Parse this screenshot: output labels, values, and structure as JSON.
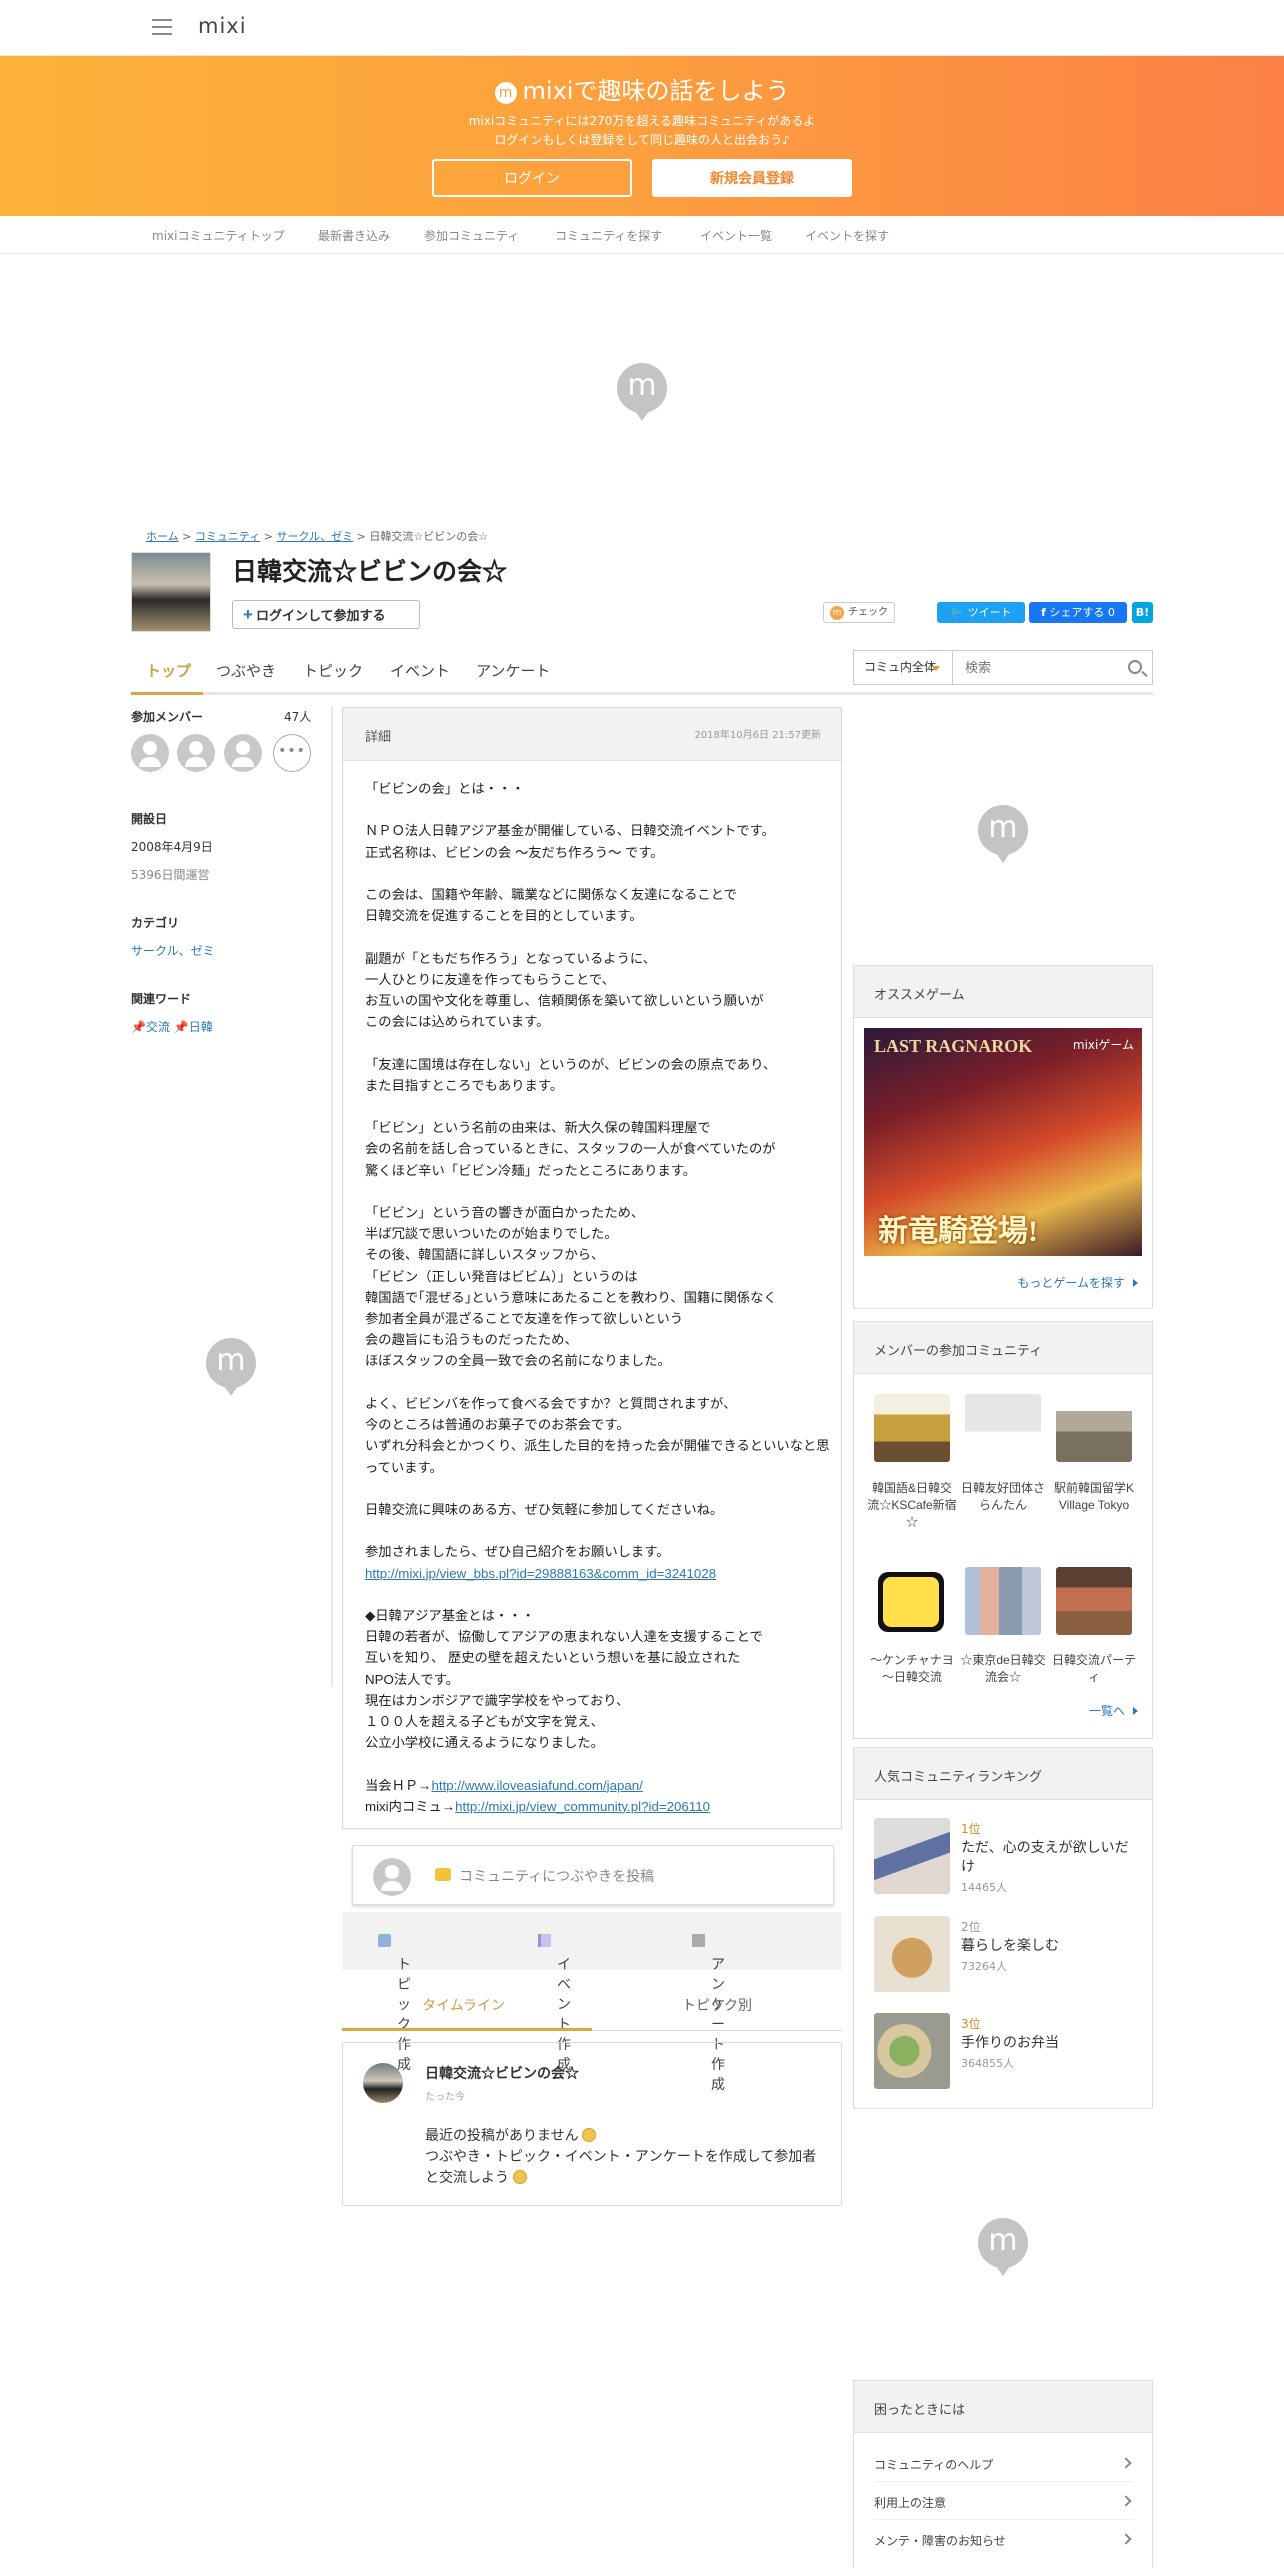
{
  "app": {
    "logo": "mixi"
  },
  "banner": {
    "title": "mixiで趣味の話をしよう",
    "line1": "mixiコミュニティには270万を超える趣味コミュニティがあるよ",
    "line2": "ログインもしくは登録をして同じ趣味の人と出会おう♪",
    "login": "ログイン",
    "register": "新規会員登録",
    "gradient": [
      "#fdb33a",
      "#fc8046"
    ]
  },
  "subnav": [
    "mixiコミュニティトップ",
    "最新書き込み",
    "参加コミュニティ",
    "コミュニティを探す",
    "イベント一覧",
    "イベントを探す"
  ],
  "breadcrumb": {
    "home": "ホーム",
    "community": "コミュニティ",
    "category": "サークル、ゼミ",
    "current": "日韓交流☆ビビンの会☆"
  },
  "community": {
    "title": "日韓交流☆ビビンの会☆",
    "join": "ログインして参加する",
    "check": "チェック",
    "tweet": "ツイート",
    "fb_share": "シェアする 0",
    "hatena": "B!"
  },
  "tabs": [
    "トップ",
    "つぶやき",
    "トピック",
    "イベント",
    "アンケート"
  ],
  "search": {
    "scope": "コミュ内全体",
    "placeholder": "検索"
  },
  "left": {
    "members_label": "参加メンバー",
    "members_count": "47人",
    "founded_label": "開設日",
    "founded": "2008年4月9日",
    "days": "5396日間運営",
    "category_label": "カテゴリ",
    "category": "サークル、ゼミ",
    "words_label": "関連ワード",
    "word1": "交流",
    "word2": "日韓"
  },
  "detail": {
    "header": "詳細",
    "updated": "2018年10月6日 21:57更新",
    "l01": "「ビビンの会」とは・・・",
    "l02": "ＮＰＯ法人日韓アジア基金が開催している、日韓交流イベントです。",
    "l03": "正式名称は、ビビンの会 ～友だち作ろう～ です。",
    "l04": "この会は、国籍や年齢、職業などに関係なく友達になることで",
    "l05": "日韓交流を促進することを目的としています。",
    "l06": "副題が「ともだち作ろう」となっているように、",
    "l07": "一人ひとりに友達を作ってもらうことで、",
    "l08": "お互いの国や文化を尊重し、信頼関係を築いて欲しいという願いが",
    "l09": "この会には込められています。",
    "l10": "「友達に国境は存在しない」というのが、ビビンの会の原点であり、",
    "l11": "また目指すところでもあります。",
    "l12": "「ビビン」という名前の由来は、新大久保の韓国料理屋で",
    "l13": "会の名前を話し合っているときに、スタッフの一人が食べていたのが",
    "l14": "驚くほど辛い「ビビン冷麺」だったところにあります。",
    "l15": "「ビビン」という音の響きが面白かったため、",
    "l16": "半ば冗談で思いついたのが始まりでした。",
    "l17": "その後、韓国語に詳しいスタッフから、",
    "l18": "「ビビン（正しい発音はビビム）」というのは",
    "l19": "韓国語で｢混ぜる｣という意味にあたることを教わり、国籍に関係なく",
    "l20": "参加者全員が混ざることで友達を作って欲しいという",
    "l21": "会の趣旨にも沿うものだったため、",
    "l22": "ほぼスタッフの全員一致で会の名前になりました。",
    "l23": "よく、ビビンバを作って食べる会ですか？と質問されますが、",
    "l24": "今のところは普通のお菓子でのお茶会です。",
    "l25": "いずれ分科会とかつくり、派生した目的を持った会が開催できるといいなと思っています。",
    "l26": "日韓交流に興味のある方、ぜひ気軽に参加してくださいね。",
    "l27": "参加されましたら、ぜひ自己紹介をお願いします。",
    "link1": "http://mixi.jp/view_bbs.pl?id=29888163&comm_id=3241028",
    "l28": "◆日韓アジア基金とは・・・",
    "l29": "日韓の若者が、協働してアジアの恵まれない人達を支援することで",
    "l30": "互いを知り、 歴史の壁を超えたいという想いを基に設立された",
    "l31": "NPO法人です。",
    "l32": "現在はカンボジアで識字学校をやっており、",
    "l33": "１００人を超える子どもが文字を覚え、",
    "l34": "公立小学校に通えるようになりました。",
    "hp_label": "当会ＨＰ→",
    "hp_link": "http://www.iloveasiafund.com/japan/",
    "mixi_label": "mixi内コミュ→",
    "mixi_link": "http://mixi.jp/view_community.pl?id=206110"
  },
  "compose": {
    "placeholder": "コミュニティにつぶやきを投稿"
  },
  "actions": {
    "topic": "トピック作成",
    "event": "イベント作成",
    "survey": "アンケート作成"
  },
  "timeline_tabs": {
    "timeline": "タイムライン",
    "by_topic": "トピック別"
  },
  "post": {
    "name": "日韓交流☆ビビンの会☆",
    "time": "たった今",
    "line1": "最近の投稿がありません",
    "line2": "つぶやき・トピック・イベント・アンケートを作成して参加者と交流しよう"
  },
  "game": {
    "header": "オススメゲーム",
    "banner_title": "LAST RAGNAROK",
    "banner_mark": "mixiゲーム",
    "banner_text": "新竜騎登場!",
    "more": "もっとゲームを探す"
  },
  "member_comms": {
    "header": "メンバーの参加コミュニティ",
    "items": [
      {
        "name": "韓国語&日韓交流☆KSCafe新宿☆"
      },
      {
        "name": "日韓友好団体さらんたん"
      },
      {
        "name": "駅前韓国留学K Village Tokyo"
      },
      {
        "name": "～ケンチャナヨ～日韓交流"
      },
      {
        "name": "☆東京de日韓交流会☆"
      },
      {
        "name": "日韓交流パーティ"
      }
    ],
    "more": "一覧へ"
  },
  "ranking": {
    "header": "人気コミュニティランキング",
    "items": [
      {
        "rank": "1位",
        "title": "ただ、心の支えが欲しいだけ",
        "count": "14465人"
      },
      {
        "rank": "2位",
        "title": "暮らしを楽しむ",
        "count": "73264人"
      },
      {
        "rank": "3位",
        "title": "手作りのお弁当",
        "count": "364855人"
      }
    ]
  },
  "help": {
    "header": "困ったときには",
    "items": [
      "コミュニティのヘルプ",
      "利用上の注意",
      "メンテ・障害のお知らせ"
    ]
  }
}
